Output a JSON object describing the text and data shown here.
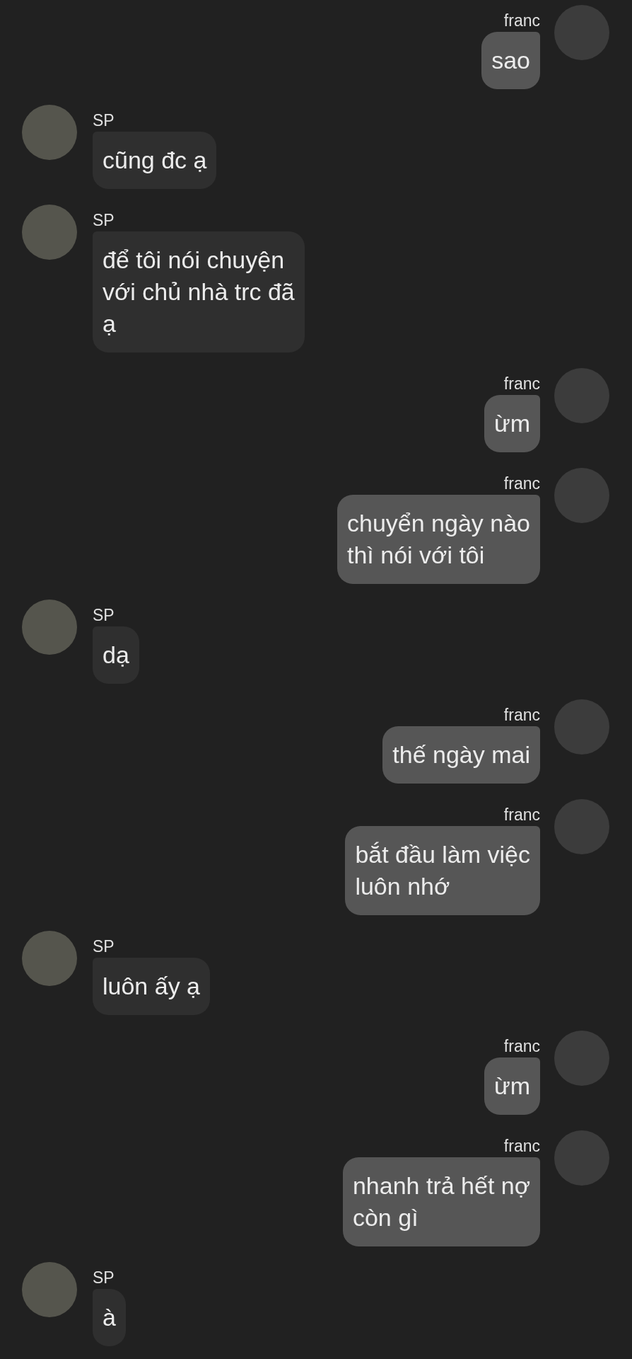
{
  "messages": [
    {
      "kind": "sent",
      "sender": "franc",
      "text": "sao"
    },
    {
      "kind": "received",
      "sender": "SP",
      "text": "cũng đc ạ"
    },
    {
      "kind": "received",
      "sender": "SP",
      "text": "để tôi nói chuyện\nvới chủ nhà trc đã\nạ"
    },
    {
      "kind": "sent",
      "sender": "franc",
      "text": "ừm"
    },
    {
      "kind": "sent",
      "sender": "franc",
      "text": "chuyển ngày nào\nthì nói với tôi"
    },
    {
      "kind": "received",
      "sender": "SP",
      "text": "dạ"
    },
    {
      "kind": "sent",
      "sender": "franc",
      "text": "thế ngày mai"
    },
    {
      "kind": "sent",
      "sender": "franc",
      "text": "bắt đầu làm việc\nluôn nhớ"
    },
    {
      "kind": "received",
      "sender": "SP",
      "text": "luôn ấy ạ"
    },
    {
      "kind": "sent",
      "sender": "franc",
      "text": "ừm"
    },
    {
      "kind": "sent",
      "sender": "franc",
      "text": "nhanh trả hết nợ\ncòn gì"
    },
    {
      "kind": "received",
      "sender": "SP",
      "text": "à"
    }
  ]
}
